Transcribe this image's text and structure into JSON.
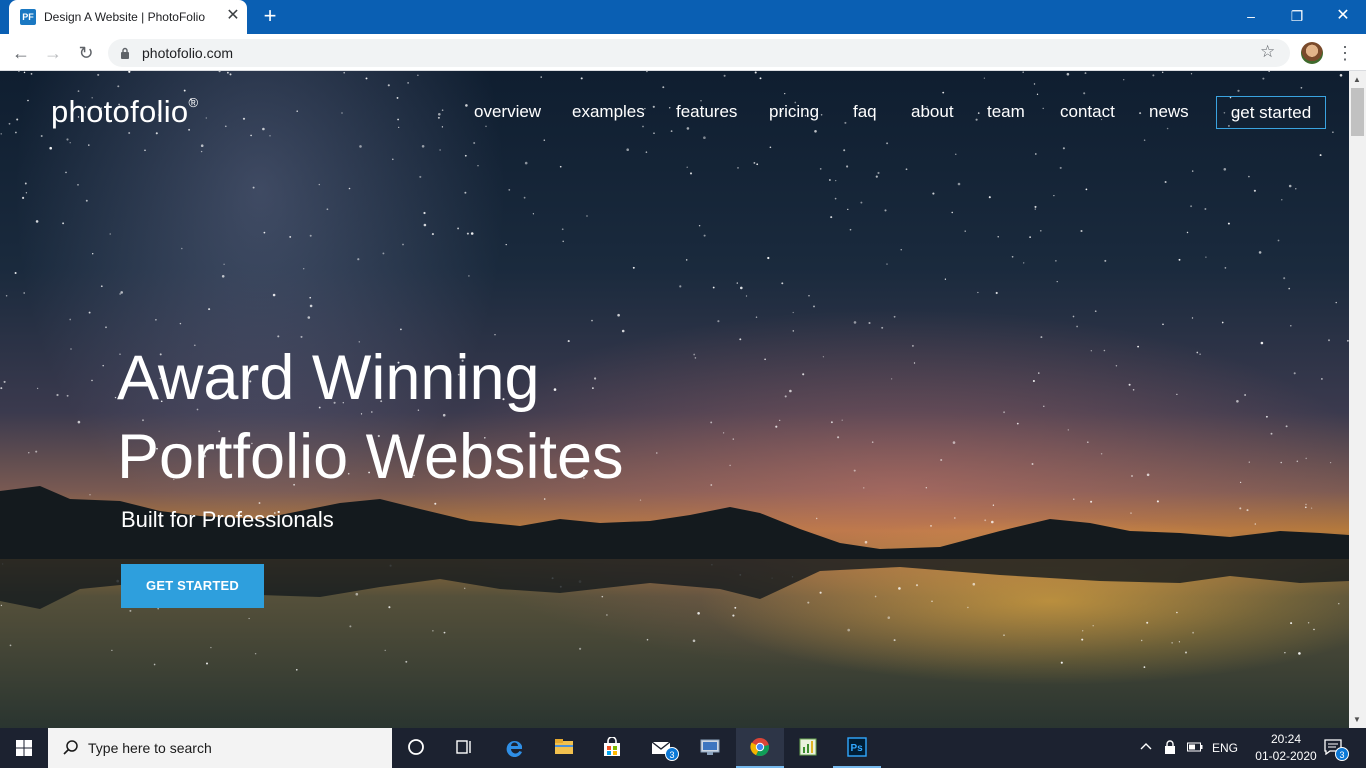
{
  "browser": {
    "tab_title": "Design A Website | PhotoFolio",
    "tab_favicon": "PF",
    "url": "photofolio.com",
    "accent": "#0a5fb3"
  },
  "site": {
    "logo": "photofolio",
    "logo_mark": "®",
    "nav": [
      "overview",
      "examples",
      "features",
      "pricing",
      "faq",
      "about",
      "team",
      "contact",
      "news"
    ],
    "nav_cta": "get started",
    "hero_title_line1": "Award Winning",
    "hero_title_line2": "Portfolio Websites",
    "hero_subtitle": "Built for Professionals",
    "hero_button": "GET STARTED",
    "button_color": "#2e9fdd"
  },
  "taskbar": {
    "search_placeholder": "Type here to search",
    "mail_badge": "3",
    "language": "ENG",
    "time": "20:24",
    "date": "01-02-2020",
    "notification_badge": "3"
  }
}
